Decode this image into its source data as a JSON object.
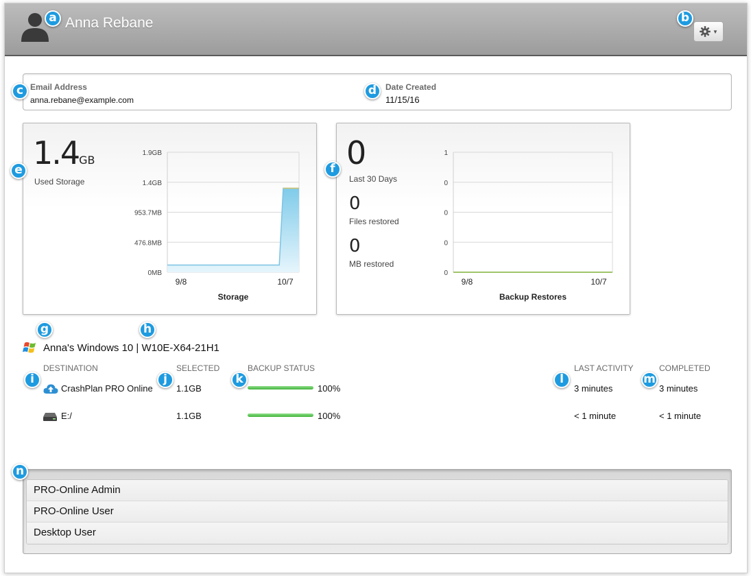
{
  "header": {
    "user_name": "Anna Rebane"
  },
  "badges": [
    "a",
    "b",
    "c",
    "d",
    "e",
    "f",
    "g",
    "h",
    "i",
    "j",
    "k",
    "l",
    "m",
    "n"
  ],
  "user_info": {
    "email_label": "Email Address",
    "email_value": "anna.rebane@example.com",
    "date_label": "Date Created",
    "date_value": "11/15/16"
  },
  "storage_card": {
    "value": "1.4",
    "unit": "GB",
    "label": "Used Storage"
  },
  "restores_card": {
    "last30_value": "0",
    "last30_label": "Last 30 Days",
    "files_value": "0",
    "files_label": "Files restored",
    "mb_value": "0",
    "mb_label": "MB restored"
  },
  "chart_data": [
    {
      "type": "area",
      "title": "Storage",
      "x": [
        "9/8",
        "10/7"
      ],
      "ytick_labels": [
        "0MB",
        "476.8MB",
        "953.7MB",
        "1.4GB",
        "1.9GB"
      ],
      "ylim": [
        0,
        2
      ],
      "series": [
        {
          "x": [
            0,
            0.85,
            0.88,
            1.0
          ],
          "values": [
            0.12,
            0.12,
            1.4,
            1.4
          ]
        }
      ],
      "grid": true,
      "color": "#7fcbea"
    },
    {
      "type": "line",
      "title": "Backup Restores",
      "x": [
        "9/8",
        "10/7"
      ],
      "ytick_labels": [
        "0",
        "0",
        "0",
        "0",
        "1"
      ],
      "ylim": [
        0,
        1
      ],
      "series": [
        {
          "x": [
            0,
            1.0
          ],
          "values": [
            0,
            0
          ]
        }
      ],
      "grid": true,
      "color": "#9fc46a"
    }
  ],
  "device": {
    "name": "Anna's Windows 10 | W10E-X64-21H1",
    "icon": "windows-logo-icon"
  },
  "backup_table": {
    "columns": {
      "destination": "DESTINATION",
      "selected": "SELECTED",
      "status": "BACKUP STATUS",
      "last_activity": "LAST ACTIVITY",
      "completed": "COMPLETED"
    },
    "rows": [
      {
        "destination": "CrashPlan PRO Online",
        "icon": "cloud-upload-icon",
        "selected": "1.1GB",
        "progress": 100,
        "progress_label": "100%",
        "last_activity": "3 minutes",
        "completed": "3 minutes"
      },
      {
        "destination": "E:/",
        "icon": "drive-icon",
        "selected": "1.1GB",
        "progress": 100,
        "progress_label": "100%",
        "last_activity": "< 1 minute",
        "completed": "< 1 minute"
      }
    ]
  },
  "roles": [
    "PRO-Online Admin",
    "PRO-Online User",
    "Desktop User"
  ]
}
